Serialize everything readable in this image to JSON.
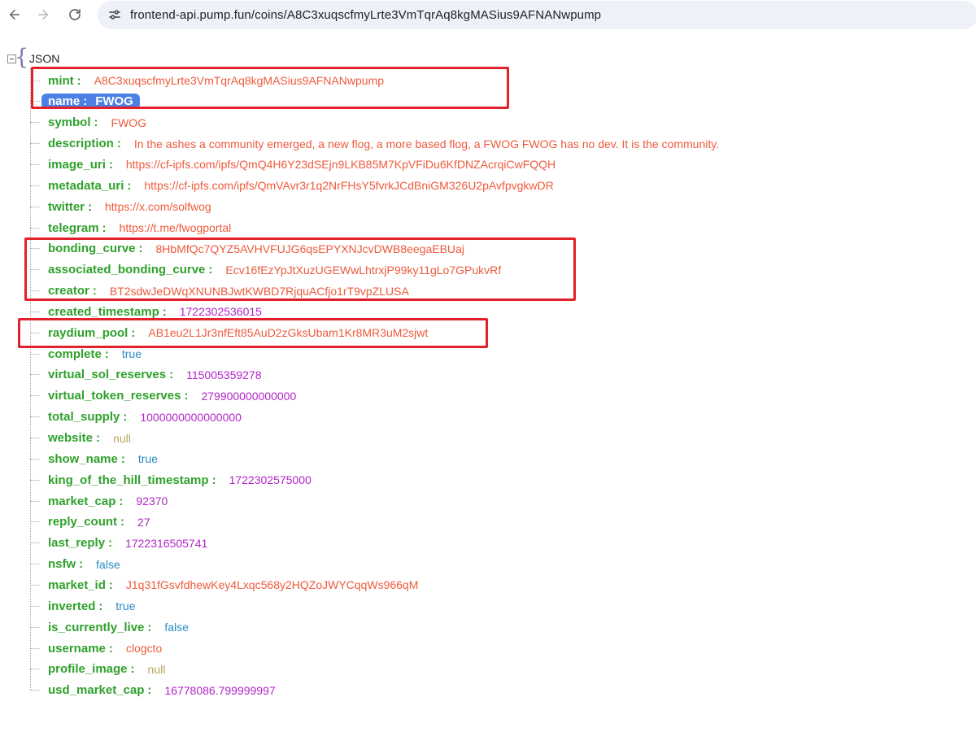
{
  "browser": {
    "url": "frontend-api.pump.fun/coins/A8C3xuqscfmyLrte3VmTqrAq8kgMASius9AFNANwpump",
    "back_icon": "arrow-left-icon",
    "forward_icon": "arrow-right-icon",
    "reload_icon": "reload-icon",
    "site_info_icon": "tune-icon"
  },
  "tree": {
    "root_label": "JSON",
    "rows": [
      {
        "key": "mint",
        "value": "A8C3xuqscfmyLrte3VmTqrAq8kgMASius9AFNANwpump",
        "type": "str"
      },
      {
        "key": "name",
        "value": "FWOG",
        "type": "str",
        "selected": true
      },
      {
        "key": "symbol",
        "value": "FWOG",
        "type": "str"
      },
      {
        "key": "description",
        "value": "In the ashes a community emerged, a new flog, a more based flog, a FWOG FWOG has no dev. It is the community.",
        "type": "str"
      },
      {
        "key": "image_uri",
        "value": "https://cf-ipfs.com/ipfs/QmQ4H6Y23dSEjn9LKB85M7KpVFiDu6KfDNZAcrqiCwFQQH",
        "type": "str"
      },
      {
        "key": "metadata_uri",
        "value": "https://cf-ipfs.com/ipfs/QmVAvr3r1q2NrFHsY5fvrkJCdBniGM326U2pAvfpvgkwDR",
        "type": "str"
      },
      {
        "key": "twitter",
        "value": "https://x.com/solfwog",
        "type": "str"
      },
      {
        "key": "telegram",
        "value": "https://t.me/fwogportal",
        "type": "str"
      },
      {
        "key": "bonding_curve",
        "value": "8HbMfQc7QYZ5AVHVFUJG6qsEPYXNJcvDWB8eegaEBUaj",
        "type": "str"
      },
      {
        "key": "associated_bonding_curve",
        "value": "Ecv16fEzYpJtXuzUGEWwLhtrxjP99ky11gLo7GPukvRf",
        "type": "str"
      },
      {
        "key": "creator",
        "value": "BT2sdwJeDWqXNUNBJwtKWBD7RjquACfjo1rT9vpZLUSA",
        "type": "str"
      },
      {
        "key": "created_timestamp",
        "value": "1722302536015",
        "type": "num"
      },
      {
        "key": "raydium_pool",
        "value": "AB1eu2L1Jr3nfEft85AuD2zGksUbam1Kr8MR3uM2sjwt",
        "type": "str"
      },
      {
        "key": "complete",
        "value": "true",
        "type": "bool"
      },
      {
        "key": "virtual_sol_reserves",
        "value": "115005359278",
        "type": "num"
      },
      {
        "key": "virtual_token_reserves",
        "value": "279900000000000",
        "type": "num"
      },
      {
        "key": "total_supply",
        "value": "1000000000000000",
        "type": "num"
      },
      {
        "key": "website",
        "value": "null",
        "type": "null"
      },
      {
        "key": "show_name",
        "value": "true",
        "type": "bool"
      },
      {
        "key": "king_of_the_hill_timestamp",
        "value": "1722302575000",
        "type": "num"
      },
      {
        "key": "market_cap",
        "value": "92370",
        "type": "num"
      },
      {
        "key": "reply_count",
        "value": "27",
        "type": "num"
      },
      {
        "key": "last_reply",
        "value": "1722316505741",
        "type": "num"
      },
      {
        "key": "nsfw",
        "value": "false",
        "type": "bool"
      },
      {
        "key": "market_id",
        "value": "J1q31fGsvfdhewKey4Lxqc568y2HQZoJWYCqqWs966qM",
        "type": "str"
      },
      {
        "key": "inverted",
        "value": "true",
        "type": "bool"
      },
      {
        "key": "is_currently_live",
        "value": "false",
        "type": "bool"
      },
      {
        "key": "username",
        "value": "clogcto",
        "type": "str"
      },
      {
        "key": "profile_image",
        "value": "null",
        "type": "null"
      },
      {
        "key": "usd_market_cap",
        "value": "16778086.799999997",
        "type": "num"
      }
    ]
  },
  "colors": {
    "key": "#2fa12c",
    "string": "#ee5a3c",
    "number": "#b224c8",
    "boolean": "#2b8cc4",
    "null": "#b8a55a",
    "highlight_box": "#e4202a",
    "selection": "#4d80e4"
  }
}
